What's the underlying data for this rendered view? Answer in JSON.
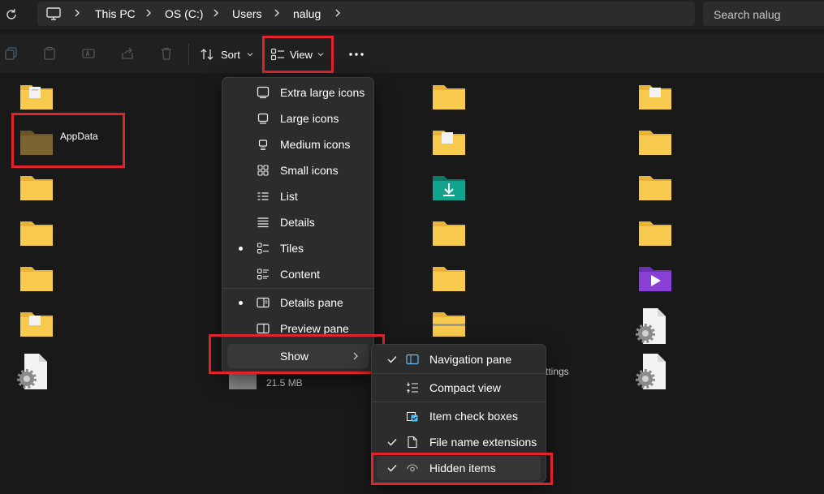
{
  "breadcrumb": {
    "items": [
      "This PC",
      "OS (C:)",
      "Users",
      "nalug"
    ]
  },
  "search": {
    "placeholder": "Search nalug"
  },
  "toolbar": {
    "sort_label": "Sort",
    "view_label": "View",
    "icons": [
      "copy-icon",
      "paste-icon",
      "rename-icon",
      "share-icon",
      "delete-icon"
    ]
  },
  "content": {
    "appdata_label": "AppData",
    "size_text": "21.5 MB",
    "partial_text": "ttings"
  },
  "view_menu": {
    "items": [
      {
        "label": "Extra large icons",
        "icon": "monitor-icon",
        "selected": false
      },
      {
        "label": "Large icons",
        "icon": "large-icons-icon",
        "selected": false
      },
      {
        "label": "Medium icons",
        "icon": "medium-icons-icon",
        "selected": false
      },
      {
        "label": "Small icons",
        "icon": "small-icons-icon",
        "selected": false
      },
      {
        "label": "List",
        "icon": "list-icon",
        "selected": false
      },
      {
        "label": "Details",
        "icon": "details-icon",
        "selected": false
      },
      {
        "label": "Tiles",
        "icon": "tiles-icon",
        "selected": true
      },
      {
        "label": "Content",
        "icon": "content-icon",
        "selected": false
      },
      {
        "label": "Details pane",
        "icon": "details-pane-icon",
        "selected": true
      },
      {
        "label": "Preview pane",
        "icon": "preview-pane-icon",
        "selected": false
      },
      {
        "label": "Show",
        "icon": "",
        "selected": false
      }
    ]
  },
  "show_menu": {
    "items": [
      {
        "label": "Navigation pane",
        "icon": "navigation-pane-icon",
        "checked": true
      },
      {
        "label": "Compact view",
        "icon": "compact-view-icon",
        "checked": false
      },
      {
        "label": "Item check boxes",
        "icon": "checkbox-icon",
        "checked": false
      },
      {
        "label": "File name extensions",
        "icon": "file-icon",
        "checked": true
      },
      {
        "label": "Hidden items",
        "icon": "eye-icon",
        "checked": true
      }
    ]
  },
  "colors": {
    "highlight": "#e1232b",
    "folder": "#f8cb4e",
    "folder_dark": "#e9b33a",
    "accent": "#4cc2ff"
  }
}
